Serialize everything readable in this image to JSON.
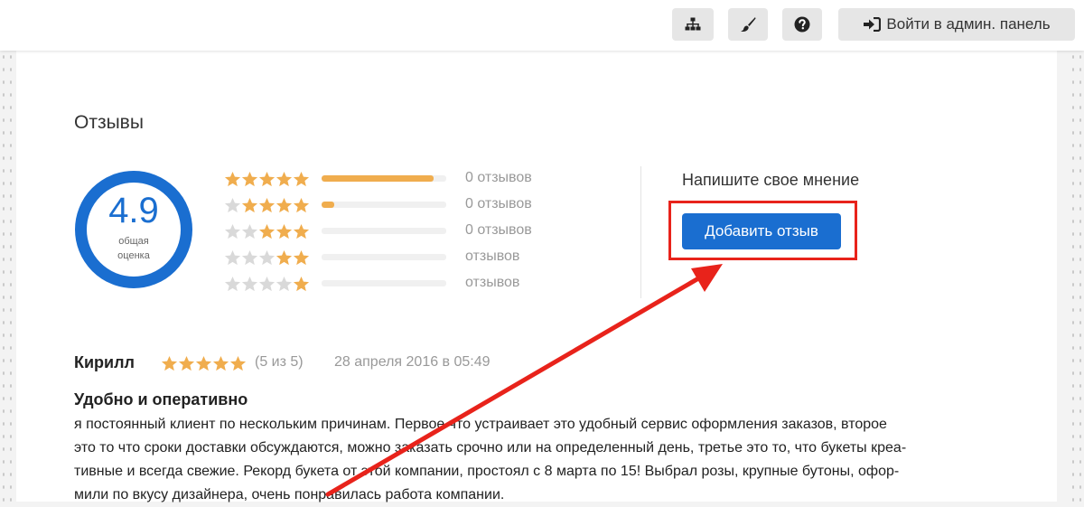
{
  "topbar": {
    "admin_label": "Войти в админ. панель",
    "icons": [
      "sitemap-icon",
      "brush-icon",
      "question-icon",
      "sign-in-icon"
    ]
  },
  "reviews": {
    "title": "Отзывы",
    "score": "4.9",
    "score_label": "общая оценка",
    "rows": [
      {
        "full_stars": 5,
        "fill_fraction": 0.9,
        "count_text": "0 отзывов"
      },
      {
        "full_stars": 4,
        "fill_fraction": 0.1,
        "count_text": "0 отзывов"
      },
      {
        "full_stars": 3,
        "fill_fraction": 0.0,
        "count_text": "0 отзывов"
      },
      {
        "full_stars": 2,
        "fill_fraction": 0.0,
        "count_text": "отзывов"
      },
      {
        "full_stars": 1,
        "fill_fraction": 0.0,
        "count_text": "отзывов"
      }
    ],
    "opinion_prompt": "Напишите свое мнение",
    "add_button": "Добавить отзыв"
  },
  "review": {
    "author": "Кирилл",
    "rating_stars": 5,
    "rating_text": "(5 из 5)",
    "date": "28 апреля 2016 в 05:49",
    "title": "Удобно и оперативно",
    "lines": [
      "я постоянный клиент по нескольким причинам. Первое что устраивает это удобный сервис оформления заказов, второе",
      "это то что сроки доставки обсуждаются, можно заказать срочно или на определенный день, третье это то, что букеты креа-",
      "тивные и всегда свежие. Рекорд букета от этой компании, простоял с 8 марта по 15! Выбрал розы, крупные бутоны, офор-",
      "мили по вкусу дизайнера, очень понравилась работа компании."
    ]
  },
  "colors": {
    "accent": "#1a6ed0",
    "star": "#f0ad4e",
    "star_empty": "#d9d9d9",
    "annotation": "#e8231b"
  }
}
